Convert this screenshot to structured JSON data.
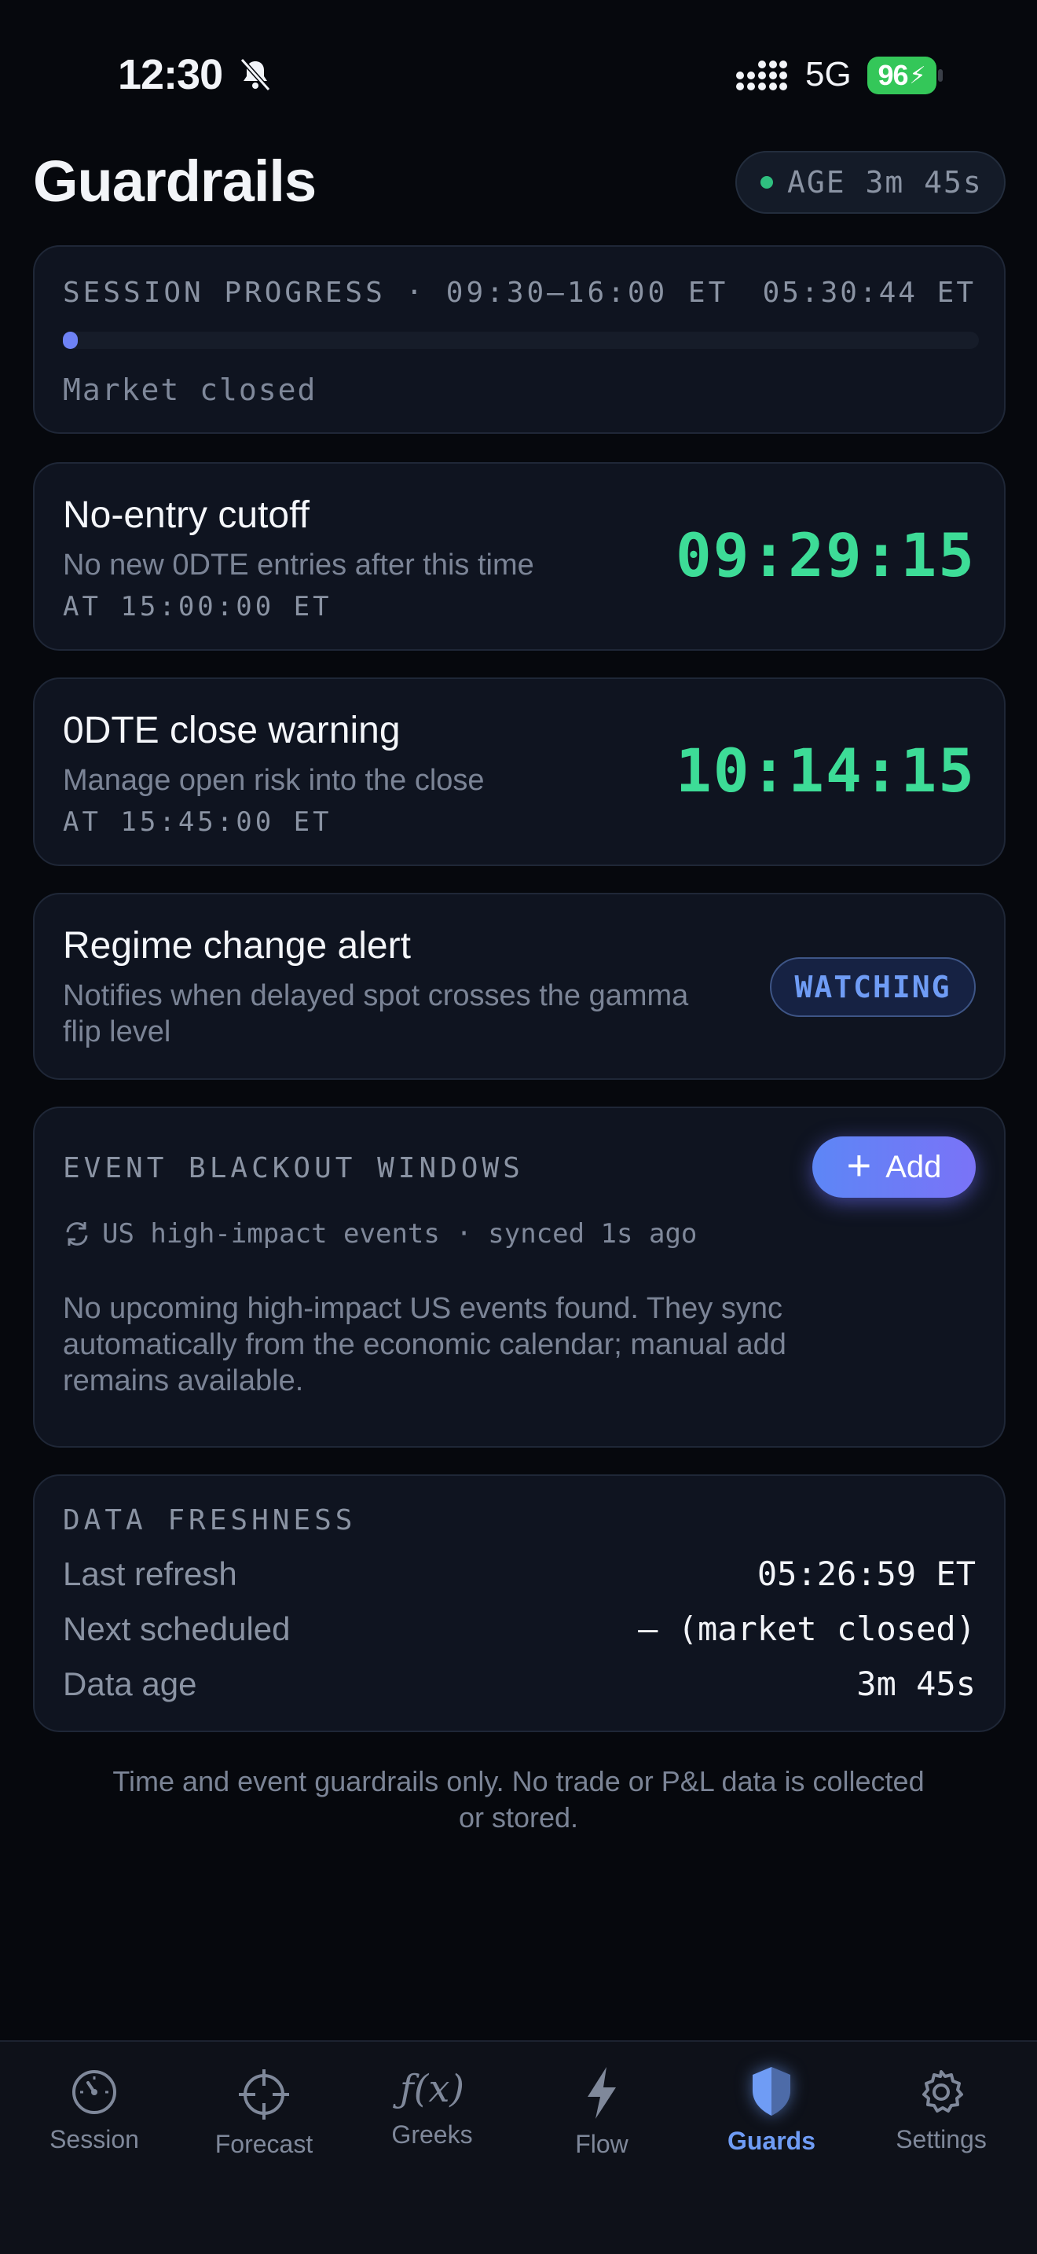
{
  "status_bar": {
    "time": "12:30",
    "network": "5G",
    "battery": "96",
    "icons": [
      "bell-slash-icon",
      "signal-icon",
      "battery-charging-icon"
    ]
  },
  "header": {
    "title": "Guardrails",
    "age_label": "AGE 3m 45s"
  },
  "session": {
    "label": "SESSION PROGRESS · 09:30–16:00 ET",
    "clock": "05:30:44 ET",
    "status": "Market closed",
    "progress": 0.01
  },
  "guards": [
    {
      "title": "No-entry cutoff",
      "subtitle": "No new 0DTE entries after this time",
      "at": "AT 15:00:00 ET",
      "countdown": "09:29:15"
    },
    {
      "title": "0DTE close warning",
      "subtitle": "Manage open risk into the close",
      "at": "AT 15:45:00 ET",
      "countdown": "10:14:15"
    }
  ],
  "regime": {
    "title": "Regime change alert",
    "subtitle_line1": "Notifies when delayed spot crosses the gamma",
    "subtitle_line2": "flip level",
    "badge": "WATCHING"
  },
  "blackout": {
    "label": "EVENT BLACKOUT WINDOWS",
    "add_label": "Add",
    "sync_text": "US high-impact events · synced 1s ago",
    "empty_line1": "No upcoming high-impact US events found. They sync",
    "empty_line2": "automatically from the economic calendar; manual add",
    "empty_line3": "remains available."
  },
  "freshness": {
    "label": "DATA FRESHNESS",
    "rows": [
      {
        "label": "Last refresh",
        "value": "05:26:59 ET"
      },
      {
        "label": "Next scheduled",
        "value": "— (market closed)"
      },
      {
        "label": "Data age",
        "value": "3m 45s"
      }
    ]
  },
  "footer": {
    "line1": "Time and event guardrails only. No trade or P&L data is collected",
    "line2": "or stored."
  },
  "tabs": [
    {
      "label": "Session",
      "icon": "gauge-icon"
    },
    {
      "label": "Forecast",
      "icon": "crosshair-icon"
    },
    {
      "label": "Greeks",
      "icon": "function-icon"
    },
    {
      "label": "Flow",
      "icon": "bolt-icon"
    },
    {
      "label": "Guards",
      "icon": "shield-icon",
      "active": true
    },
    {
      "label": "Settings",
      "icon": "gear-icon"
    }
  ],
  "colors": {
    "background": "#06080d",
    "card": "#0f1420",
    "countdown_green": "#3ddc97",
    "accent_blue": "#6f9cf5",
    "battery_green": "#34c759"
  }
}
